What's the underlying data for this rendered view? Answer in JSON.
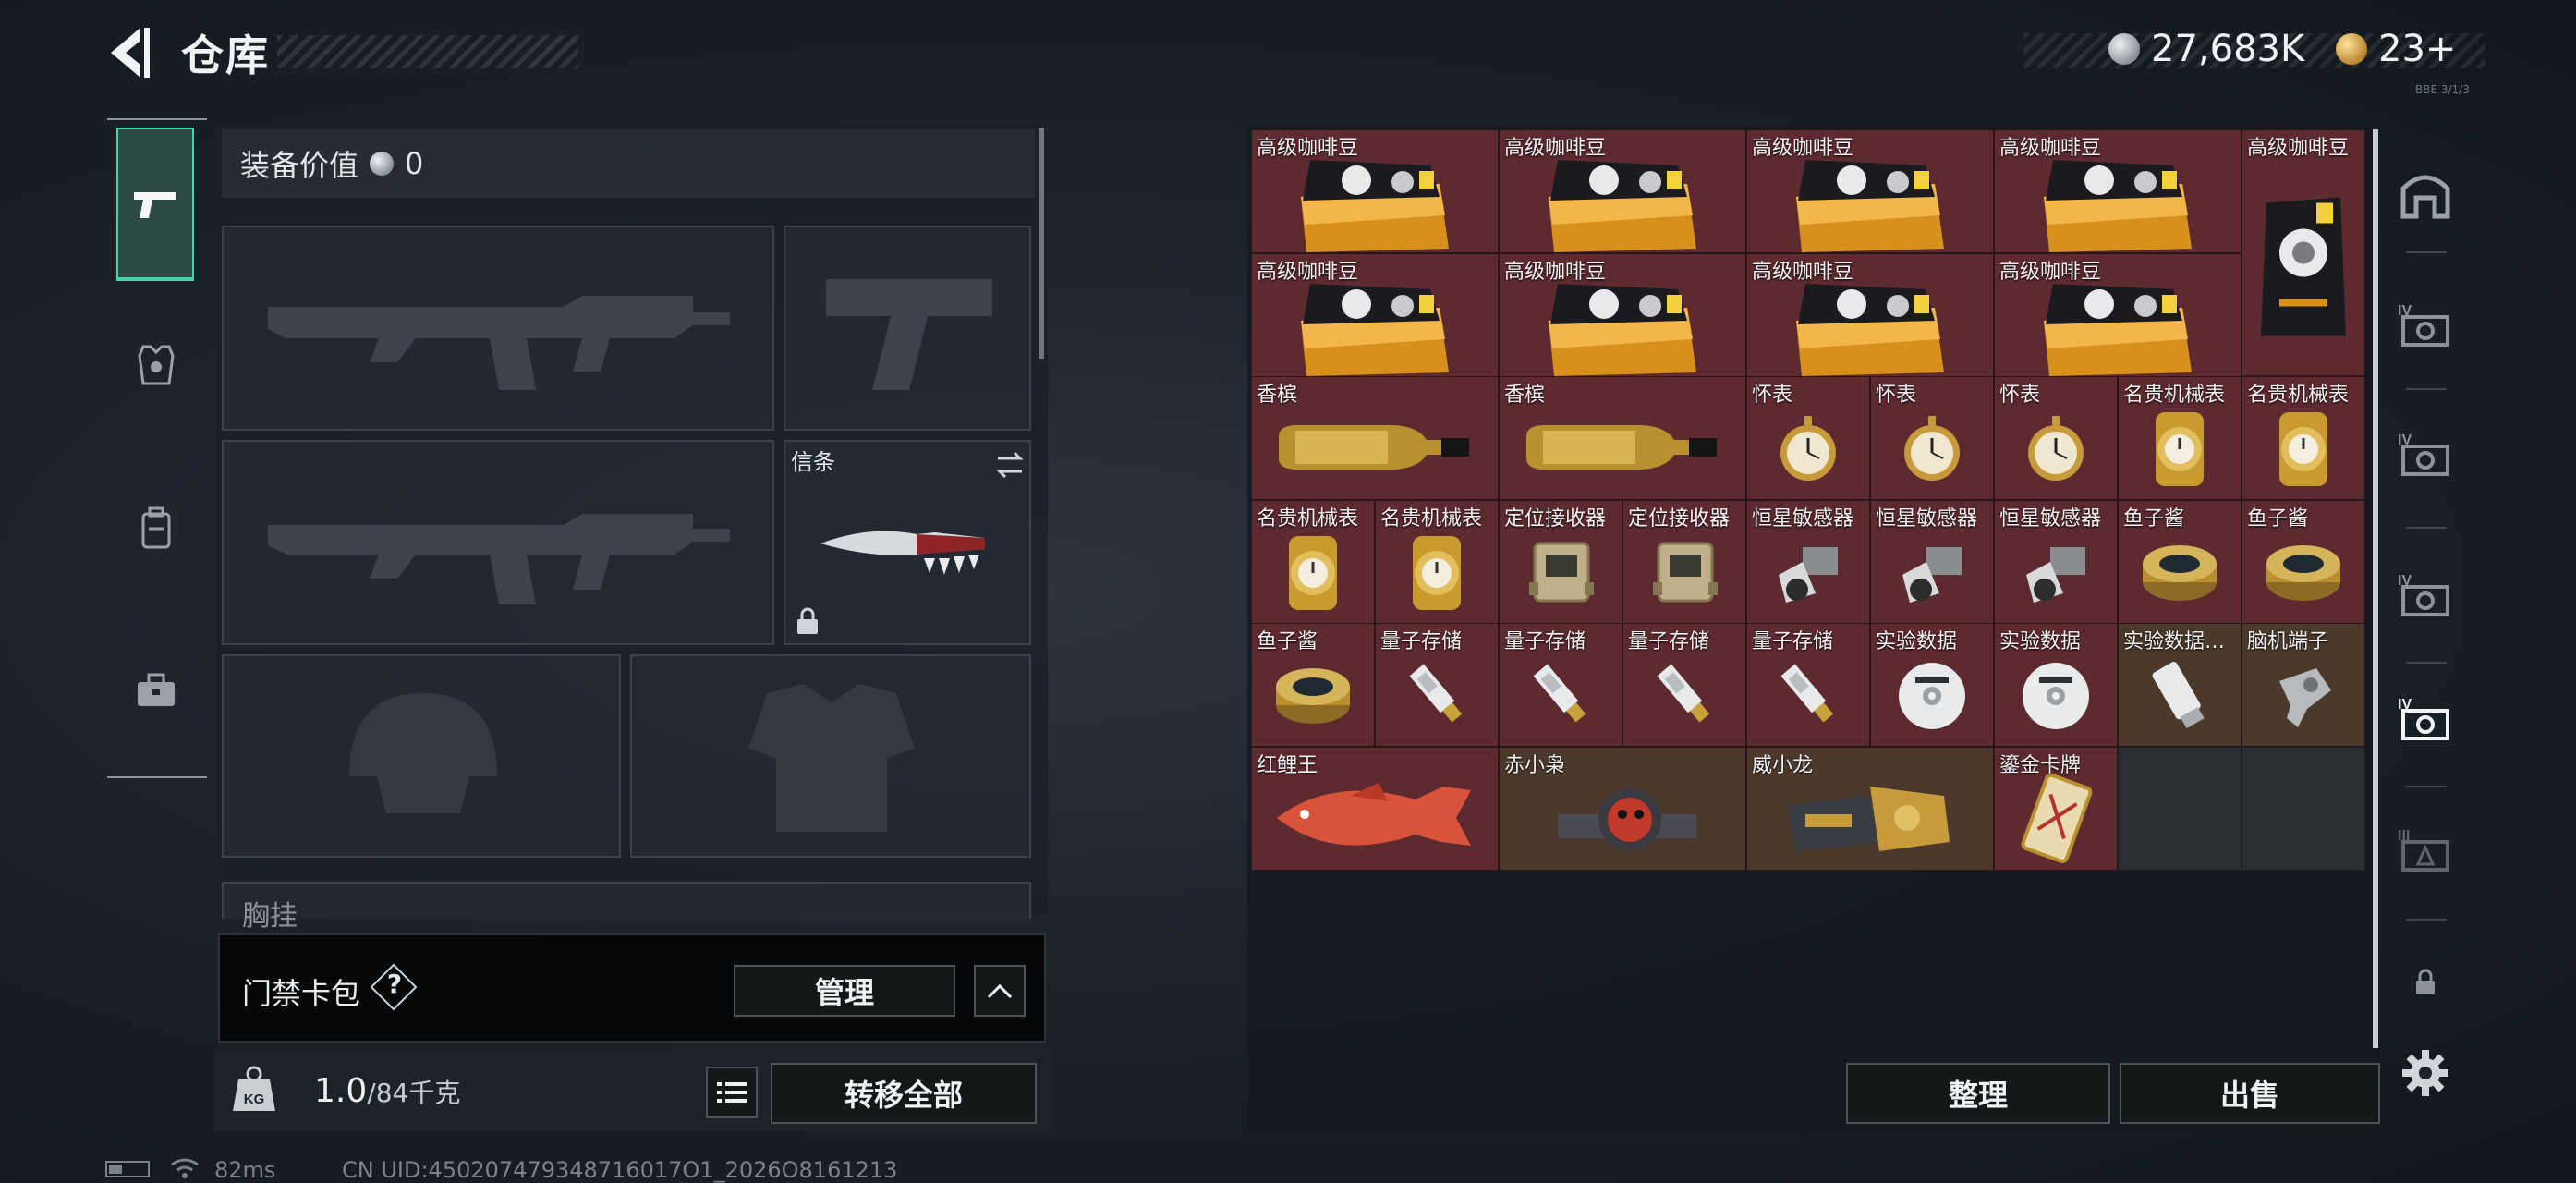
{
  "header": {
    "title": "仓库",
    "currency_main": "27,683K",
    "currency_secondary": "23+",
    "tiny_label": "BBE 3/1/3"
  },
  "loadout": {
    "equip_value_label": "装备价值",
    "equip_value": "0",
    "knife_slot_label": "信条",
    "chest_label": "胸挂"
  },
  "keycard": {
    "label": "门禁卡包",
    "help": "?",
    "manage_button": "管理"
  },
  "weight": {
    "current": "1.0",
    "max": "/84千克"
  },
  "buttons": {
    "transfer_all": "转移全部",
    "organize": "整理",
    "sell": "出售"
  },
  "status": {
    "ping": "82ms",
    "uid": "CN UID:450207479348716017O1_2026O8161213"
  },
  "items": [
    {
      "label": "高级咖啡豆",
      "type": "coffee-bag-icon"
    },
    {
      "label": "高级咖啡豆",
      "type": "coffee-bag-icon"
    },
    {
      "label": "高级咖啡豆",
      "type": "coffee-bag-icon"
    },
    {
      "label": "高级咖啡豆",
      "type": "coffee-bag-icon"
    },
    {
      "label": "高级咖啡豆",
      "type": "coffee-bag-tall-icon"
    },
    {
      "label": "高级咖啡豆",
      "type": "coffee-bag-icon"
    },
    {
      "label": "高级咖啡豆",
      "type": "coffee-bag-icon"
    },
    {
      "label": "高级咖啡豆",
      "type": "coffee-bag-icon"
    },
    {
      "label": "高级咖啡豆",
      "type": "coffee-bag-icon"
    },
    {
      "label": "香槟",
      "type": "champagne-bottle-icon"
    },
    {
      "label": "香槟",
      "type": "champagne-bottle-icon"
    },
    {
      "label": "怀表",
      "type": "pocket-watch-icon"
    },
    {
      "label": "怀表",
      "type": "pocket-watch-icon"
    },
    {
      "label": "怀表",
      "type": "pocket-watch-icon"
    },
    {
      "label": "名贵机械表",
      "type": "wrist-watch-icon"
    },
    {
      "label": "名贵机械表",
      "type": "wrist-watch-icon"
    },
    {
      "label": "名贵机械表",
      "type": "wrist-watch-icon"
    },
    {
      "label": "名贵机械表",
      "type": "wrist-watch-icon"
    },
    {
      "label": "定位接收器",
      "type": "locator-receiver-icon"
    },
    {
      "label": "定位接收器",
      "type": "locator-receiver-icon"
    },
    {
      "label": "恒星敏感器",
      "type": "star-sensor-icon"
    },
    {
      "label": "恒星敏感器",
      "type": "star-sensor-icon"
    },
    {
      "label": "恒星敏感器",
      "type": "star-sensor-icon"
    },
    {
      "label": "鱼子酱",
      "type": "caviar-tin-icon"
    },
    {
      "label": "鱼子酱",
      "type": "caviar-tin-icon"
    },
    {
      "label": "鱼子酱",
      "type": "caviar-tin-icon"
    },
    {
      "label": "量子存储",
      "type": "usb-drive-icon"
    },
    {
      "label": "量子存储",
      "type": "usb-drive-icon"
    },
    {
      "label": "量子存储",
      "type": "usb-drive-icon"
    },
    {
      "label": "量子存储",
      "type": "usb-drive-icon"
    },
    {
      "label": "实验数据",
      "type": "disc-icon"
    },
    {
      "label": "实验数据",
      "type": "disc-icon"
    },
    {
      "label": "实验数据…",
      "type": "data-drive-icon"
    },
    {
      "label": "脑机端子",
      "type": "brain-terminal-icon"
    },
    {
      "label": "红鲤王",
      "type": "red-carp-icon"
    },
    {
      "label": "赤小枭",
      "type": "red-owl-figure-icon"
    },
    {
      "label": "威小龙",
      "type": "gold-gauntlet-icon"
    },
    {
      "label": "鎏金卡牌",
      "type": "gold-card-icon"
    }
  ],
  "colors": {
    "accent": "#3bd8a8",
    "item_red": "#5d2a30",
    "item_brown": "#4b3a2c"
  }
}
